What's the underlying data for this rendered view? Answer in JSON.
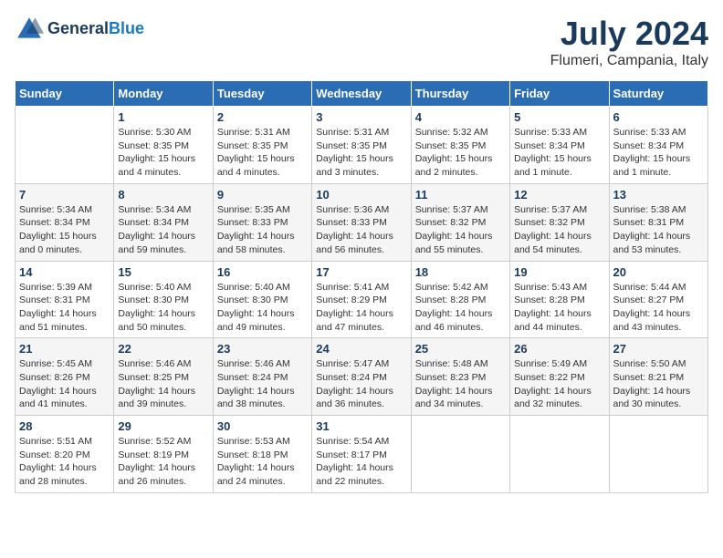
{
  "header": {
    "logo_general": "General",
    "logo_blue": "Blue",
    "month_year": "July 2024",
    "location": "Flumeri, Campania, Italy"
  },
  "weekdays": [
    "Sunday",
    "Monday",
    "Tuesday",
    "Wednesday",
    "Thursday",
    "Friday",
    "Saturday"
  ],
  "weeks": [
    [
      {
        "day": "",
        "sunrise": "",
        "sunset": "",
        "daylight": ""
      },
      {
        "day": "1",
        "sunrise": "Sunrise: 5:30 AM",
        "sunset": "Sunset: 8:35 PM",
        "daylight": "Daylight: 15 hours and 4 minutes."
      },
      {
        "day": "2",
        "sunrise": "Sunrise: 5:31 AM",
        "sunset": "Sunset: 8:35 PM",
        "daylight": "Daylight: 15 hours and 4 minutes."
      },
      {
        "day": "3",
        "sunrise": "Sunrise: 5:31 AM",
        "sunset": "Sunset: 8:35 PM",
        "daylight": "Daylight: 15 hours and 3 minutes."
      },
      {
        "day": "4",
        "sunrise": "Sunrise: 5:32 AM",
        "sunset": "Sunset: 8:35 PM",
        "daylight": "Daylight: 15 hours and 2 minutes."
      },
      {
        "day": "5",
        "sunrise": "Sunrise: 5:33 AM",
        "sunset": "Sunset: 8:34 PM",
        "daylight": "Daylight: 15 hours and 1 minute."
      },
      {
        "day": "6",
        "sunrise": "Sunrise: 5:33 AM",
        "sunset": "Sunset: 8:34 PM",
        "daylight": "Daylight: 15 hours and 1 minute."
      }
    ],
    [
      {
        "day": "7",
        "sunrise": "Sunrise: 5:34 AM",
        "sunset": "Sunset: 8:34 PM",
        "daylight": "Daylight: 15 hours and 0 minutes."
      },
      {
        "day": "8",
        "sunrise": "Sunrise: 5:34 AM",
        "sunset": "Sunset: 8:34 PM",
        "daylight": "Daylight: 14 hours and 59 minutes."
      },
      {
        "day": "9",
        "sunrise": "Sunrise: 5:35 AM",
        "sunset": "Sunset: 8:33 PM",
        "daylight": "Daylight: 14 hours and 58 minutes."
      },
      {
        "day": "10",
        "sunrise": "Sunrise: 5:36 AM",
        "sunset": "Sunset: 8:33 PM",
        "daylight": "Daylight: 14 hours and 56 minutes."
      },
      {
        "day": "11",
        "sunrise": "Sunrise: 5:37 AM",
        "sunset": "Sunset: 8:32 PM",
        "daylight": "Daylight: 14 hours and 55 minutes."
      },
      {
        "day": "12",
        "sunrise": "Sunrise: 5:37 AM",
        "sunset": "Sunset: 8:32 PM",
        "daylight": "Daylight: 14 hours and 54 minutes."
      },
      {
        "day": "13",
        "sunrise": "Sunrise: 5:38 AM",
        "sunset": "Sunset: 8:31 PM",
        "daylight": "Daylight: 14 hours and 53 minutes."
      }
    ],
    [
      {
        "day": "14",
        "sunrise": "Sunrise: 5:39 AM",
        "sunset": "Sunset: 8:31 PM",
        "daylight": "Daylight: 14 hours and 51 minutes."
      },
      {
        "day": "15",
        "sunrise": "Sunrise: 5:40 AM",
        "sunset": "Sunset: 8:30 PM",
        "daylight": "Daylight: 14 hours and 50 minutes."
      },
      {
        "day": "16",
        "sunrise": "Sunrise: 5:40 AM",
        "sunset": "Sunset: 8:30 PM",
        "daylight": "Daylight: 14 hours and 49 minutes."
      },
      {
        "day": "17",
        "sunrise": "Sunrise: 5:41 AM",
        "sunset": "Sunset: 8:29 PM",
        "daylight": "Daylight: 14 hours and 47 minutes."
      },
      {
        "day": "18",
        "sunrise": "Sunrise: 5:42 AM",
        "sunset": "Sunset: 8:28 PM",
        "daylight": "Daylight: 14 hours and 46 minutes."
      },
      {
        "day": "19",
        "sunrise": "Sunrise: 5:43 AM",
        "sunset": "Sunset: 8:28 PM",
        "daylight": "Daylight: 14 hours and 44 minutes."
      },
      {
        "day": "20",
        "sunrise": "Sunrise: 5:44 AM",
        "sunset": "Sunset: 8:27 PM",
        "daylight": "Daylight: 14 hours and 43 minutes."
      }
    ],
    [
      {
        "day": "21",
        "sunrise": "Sunrise: 5:45 AM",
        "sunset": "Sunset: 8:26 PM",
        "daylight": "Daylight: 14 hours and 41 minutes."
      },
      {
        "day": "22",
        "sunrise": "Sunrise: 5:46 AM",
        "sunset": "Sunset: 8:25 PM",
        "daylight": "Daylight: 14 hours and 39 minutes."
      },
      {
        "day": "23",
        "sunrise": "Sunrise: 5:46 AM",
        "sunset": "Sunset: 8:24 PM",
        "daylight": "Daylight: 14 hours and 38 minutes."
      },
      {
        "day": "24",
        "sunrise": "Sunrise: 5:47 AM",
        "sunset": "Sunset: 8:24 PM",
        "daylight": "Daylight: 14 hours and 36 minutes."
      },
      {
        "day": "25",
        "sunrise": "Sunrise: 5:48 AM",
        "sunset": "Sunset: 8:23 PM",
        "daylight": "Daylight: 14 hours and 34 minutes."
      },
      {
        "day": "26",
        "sunrise": "Sunrise: 5:49 AM",
        "sunset": "Sunset: 8:22 PM",
        "daylight": "Daylight: 14 hours and 32 minutes."
      },
      {
        "day": "27",
        "sunrise": "Sunrise: 5:50 AM",
        "sunset": "Sunset: 8:21 PM",
        "daylight": "Daylight: 14 hours and 30 minutes."
      }
    ],
    [
      {
        "day": "28",
        "sunrise": "Sunrise: 5:51 AM",
        "sunset": "Sunset: 8:20 PM",
        "daylight": "Daylight: 14 hours and 28 minutes."
      },
      {
        "day": "29",
        "sunrise": "Sunrise: 5:52 AM",
        "sunset": "Sunset: 8:19 PM",
        "daylight": "Daylight: 14 hours and 26 minutes."
      },
      {
        "day": "30",
        "sunrise": "Sunrise: 5:53 AM",
        "sunset": "Sunset: 8:18 PM",
        "daylight": "Daylight: 14 hours and 24 minutes."
      },
      {
        "day": "31",
        "sunrise": "Sunrise: 5:54 AM",
        "sunset": "Sunset: 8:17 PM",
        "daylight": "Daylight: 14 hours and 22 minutes."
      },
      {
        "day": "",
        "sunrise": "",
        "sunset": "",
        "daylight": ""
      },
      {
        "day": "",
        "sunrise": "",
        "sunset": "",
        "daylight": ""
      },
      {
        "day": "",
        "sunrise": "",
        "sunset": "",
        "daylight": ""
      }
    ]
  ]
}
